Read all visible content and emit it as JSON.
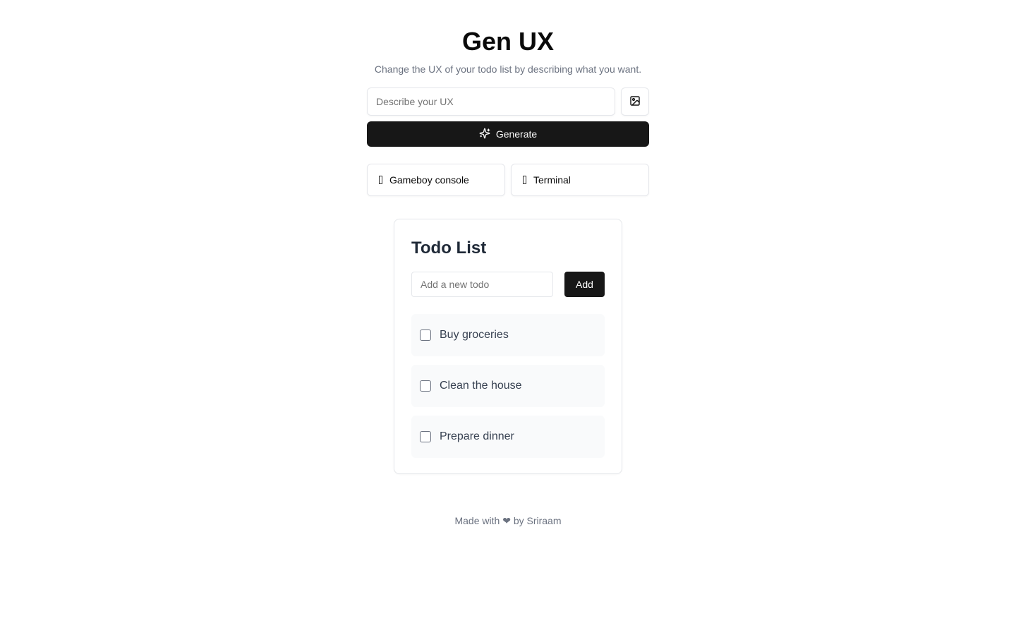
{
  "header": {
    "title": "Gen UX",
    "subtitle": "Change the UX of your todo list by describing what you want."
  },
  "prompt": {
    "placeholder": "Describe your UX",
    "value": "",
    "image_icon": "image-icon",
    "generate_label": "Generate",
    "generate_icon": "sparkles-icon"
  },
  "presets": [
    {
      "label": "Gameboy console",
      "icon": "missing-glyph"
    },
    {
      "label": "Terminal",
      "icon": "missing-glyph"
    }
  ],
  "todo": {
    "title": "Todo List",
    "input_placeholder": "Add a new todo",
    "add_label": "Add",
    "items": [
      {
        "text": "Buy groceries",
        "done": false
      },
      {
        "text": "Clean the house",
        "done": false
      },
      {
        "text": "Prepare dinner",
        "done": false
      }
    ]
  },
  "footer": {
    "prefix": "Made with",
    "heart": "❤",
    "suffix": "by Sriraam"
  },
  "colors": {
    "primary": "#171717",
    "muted_text": "#6b7280",
    "border": "#e5e7eb",
    "item_bg": "#f9fafb"
  }
}
